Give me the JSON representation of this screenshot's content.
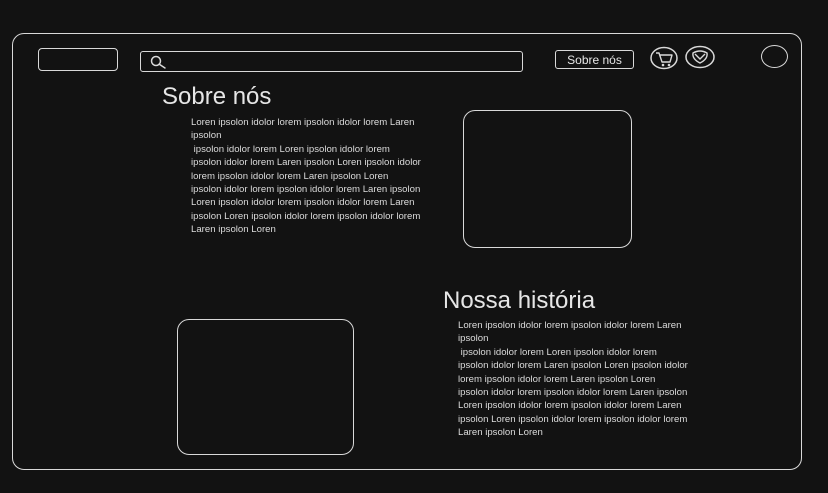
{
  "header": {
    "search": {
      "value": "",
      "placeholder": ""
    },
    "nav_label": "Sobre nós",
    "icons": [
      "search-icon",
      "cart-icon",
      "brand-logo-icon",
      "user-avatar"
    ]
  },
  "about": {
    "title": "Sobre nós",
    "text": "Loren ipsolon idolor lorem ipsolon idolor lorem Laren ipsolon\n ipsolon idolor lorem Loren ipsolon idolor lorem ipsolon idolor lorem Laren ipsolon Loren ipsolon idolor lorem ipsolon idolor lorem Laren ipsolon Loren ipsolon idolor lorem ipsolon idolor lorem Laren ipsolon Loren ipsolon idolor lorem ipsolon idolor lorem Laren ipsolon Loren ipsolon idolor lorem ipsolon idolor lorem Laren ipsolon Loren"
  },
  "history": {
    "title": "Nossa história",
    "text": "Loren ipsolon idolor lorem ipsolon idolor lorem Laren ipsolon\n ipsolon idolor lorem Loren ipsolon idolor lorem ipsolon idolor lorem Laren ipsolon Loren ipsolon idolor lorem ipsolon idolor lorem Laren ipsolon Loren ipsolon idolor lorem ipsolon idolor lorem Laren ipsolon Loren ipsolon idolor lorem ipsolon idolor lorem Laren ipsolon Loren ipsolon idolor lorem ipsolon idolor lorem Laren ipsolon Loren"
  },
  "colors": {
    "background": "#121212",
    "stroke": "#d9d9d9",
    "text": "#e6e6e6"
  }
}
